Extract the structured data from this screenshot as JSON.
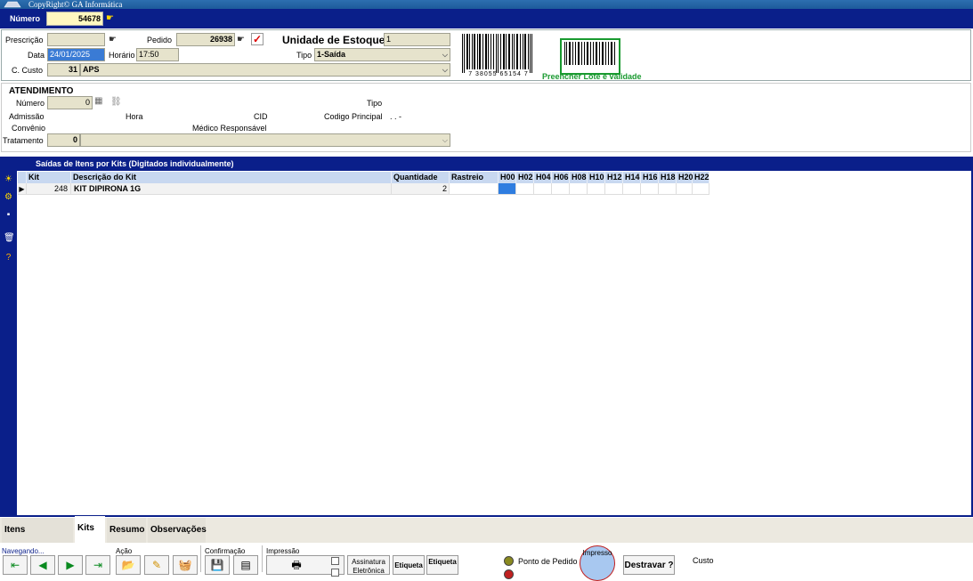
{
  "window": {
    "copyright": "CopyRight© GA Informática"
  },
  "header": {
    "numero_label": "Número",
    "numero_value": "54678"
  },
  "form": {
    "prescricao_label": "Prescrição",
    "prescricao_value": "",
    "pedido_label": "Pedido",
    "pedido_value": "26938",
    "unidade_label": "Unidade de Estoque",
    "unidade_value": "1",
    "data_label": "Data",
    "data_value": "24/01/2025",
    "horario_label": "Horário",
    "horario_value": "17:50",
    "tipo_label": "Tipo",
    "tipo_value": "1-Saída",
    "ccusto_label": "C. Custo",
    "ccusto_code": "31",
    "ccusto_value": "APS",
    "barcode_text": "7 38055 65154 7",
    "lote_text": "Preencher Lote e validade"
  },
  "atendimento": {
    "title": "ATENDIMENTO",
    "numero_label": "Número",
    "numero_value": "0",
    "tipo_label": "Tipo",
    "admissao_label": "Admissão",
    "hora_label": "Hora",
    "cid_label": "CID",
    "codigo_label": "Codigo Principal",
    "codigo_value": ". . -",
    "convenio_label": "Convênio",
    "medico_label": "Médico Responsável",
    "tratamento_label": "Tratamento",
    "tratamento_value": "0",
    "tratamento_desc": ""
  },
  "kits": {
    "title": "Saídas de Itens por Kits (Digitados individualmente)",
    "columns": [
      "Kit",
      "Descrição do Kit",
      "Quantidade",
      "Rastreio",
      "H00",
      "H02",
      "H04",
      "H06",
      "H08",
      "H10",
      "H12",
      "H14",
      "H16",
      "H18",
      "H20",
      "H22"
    ],
    "rows": [
      {
        "kit": "248",
        "descricao": "KIT DIPIRONA 1G",
        "quantidade": "2",
        "rastreio": ""
      }
    ]
  },
  "tabs": [
    "Itens Individuais",
    "Kits",
    "Resumo",
    "Observações"
  ],
  "bottom": {
    "navegando": "Navegando...",
    "acao": "Ação",
    "confirmacao": "Confirmação",
    "impressao": "Impressão",
    "assinatura": "Assinatura Eletrônica",
    "etiqueta1": "Etiqueta",
    "etiqueta2": "Etiqueta",
    "ponto_pedido": "Ponto de Pedido",
    "impresso": "Impresso",
    "destravar": "Destravar ?",
    "custo_label": "Custo"
  }
}
